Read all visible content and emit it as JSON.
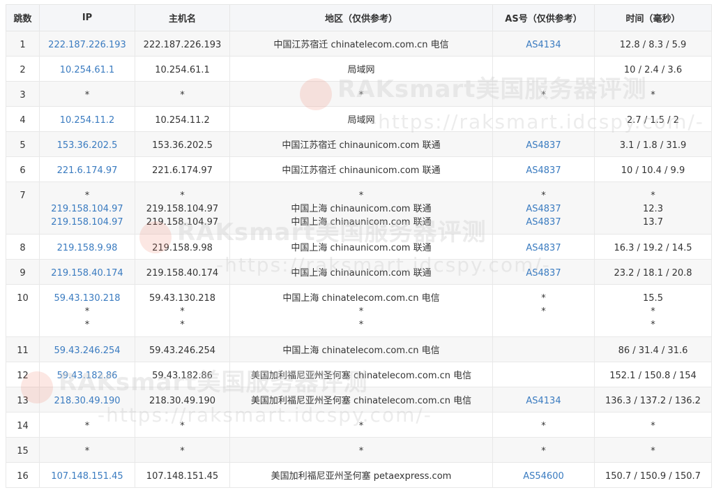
{
  "headers": [
    "跳数",
    "IP",
    "主机名",
    "地区（仅供参考）",
    "AS号（仅供参考）",
    "时间（毫秒）"
  ],
  "rows": [
    {
      "hop": "1",
      "ip": [
        "222.187.226.193"
      ],
      "host": [
        "222.187.226.193"
      ],
      "region": [
        "中国江苏宿迁 chinatelecom.com.cn 电信"
      ],
      "as": [
        "AS4134"
      ],
      "time": [
        "12.8 / 8.3 / 5.9"
      ]
    },
    {
      "hop": "2",
      "ip": [
        "10.254.61.1"
      ],
      "host": [
        "10.254.61.1"
      ],
      "region": [
        "局域网"
      ],
      "as": [
        ""
      ],
      "time": [
        "10 / 2.4 / 3.6"
      ]
    },
    {
      "hop": "3",
      "ip": [
        "*"
      ],
      "host": [
        "*"
      ],
      "region": [
        "*"
      ],
      "as": [
        "*"
      ],
      "time": [
        "*"
      ]
    },
    {
      "hop": "4",
      "ip": [
        "10.254.11.2"
      ],
      "host": [
        "10.254.11.2"
      ],
      "region": [
        "局域网"
      ],
      "as": [
        ""
      ],
      "time": [
        "2.7 / 1.5 / 2"
      ]
    },
    {
      "hop": "5",
      "ip": [
        "153.36.202.5"
      ],
      "host": [
        "153.36.202.5"
      ],
      "region": [
        "中国江苏宿迁 chinaunicom.com 联通"
      ],
      "as": [
        "AS4837"
      ],
      "time": [
        "3.1 / 1.8 / 31.9"
      ]
    },
    {
      "hop": "6",
      "ip": [
        "221.6.174.97"
      ],
      "host": [
        "221.6.174.97"
      ],
      "region": [
        "中国江苏宿迁 chinaunicom.com 联通"
      ],
      "as": [
        "AS4837"
      ],
      "time": [
        "10 / 10.4 / 9.9"
      ]
    },
    {
      "hop": "7",
      "ip": [
        "*",
        "219.158.104.97",
        "219.158.104.97"
      ],
      "host": [
        "*",
        "219.158.104.97",
        "219.158.104.97"
      ],
      "region": [
        "*",
        "中国上海 chinaunicom.com 联通",
        "中国上海 chinaunicom.com 联通"
      ],
      "as": [
        "*",
        "AS4837",
        "AS4837"
      ],
      "time": [
        "*",
        "12.3",
        "13.7"
      ]
    },
    {
      "hop": "8",
      "ip": [
        "219.158.9.98"
      ],
      "host": [
        "219.158.9.98"
      ],
      "region": [
        "中国上海 chinaunicom.com 联通"
      ],
      "as": [
        "AS4837"
      ],
      "time": [
        "16.3 / 19.2 / 14.5"
      ]
    },
    {
      "hop": "9",
      "ip": [
        "219.158.40.174"
      ],
      "host": [
        "219.158.40.174"
      ],
      "region": [
        "中国上海 chinaunicom.com 联通"
      ],
      "as": [
        "AS4837"
      ],
      "time": [
        "23.2 / 18.1 / 20.8"
      ]
    },
    {
      "hop": "10",
      "ip": [
        "59.43.130.218",
        "*",
        "*"
      ],
      "host": [
        "59.43.130.218",
        "*",
        "*"
      ],
      "region": [
        "中国上海 chinatelecom.com.cn 电信",
        "*",
        "*"
      ],
      "as": [
        "",
        "*",
        "*"
      ],
      "time": [
        "15.5",
        "*",
        "*"
      ]
    },
    {
      "hop": "11",
      "ip": [
        "59.43.246.254"
      ],
      "host": [
        "59.43.246.254"
      ],
      "region": [
        "中国上海 chinatelecom.com.cn 电信"
      ],
      "as": [
        ""
      ],
      "time": [
        "86 / 31.4 / 31.6"
      ]
    },
    {
      "hop": "12",
      "ip": [
        "59.43.182.86"
      ],
      "host": [
        "59.43.182.86"
      ],
      "region": [
        "美国加利福尼亚州圣何塞 chinatelecom.com.cn 电信"
      ],
      "as": [
        ""
      ],
      "time": [
        "152.1 / 150.8 / 154"
      ]
    },
    {
      "hop": "13",
      "ip": [
        "218.30.49.190"
      ],
      "host": [
        "218.30.49.190"
      ],
      "region": [
        "美国加利福尼亚州圣何塞 chinatelecom.com.cn 电信"
      ],
      "as": [
        "AS4134"
      ],
      "time": [
        "136.3 / 137.2 / 136.2"
      ]
    },
    {
      "hop": "14",
      "ip": [
        "*"
      ],
      "host": [
        "*"
      ],
      "region": [
        "*"
      ],
      "as": [
        "*"
      ],
      "time": [
        "*"
      ]
    },
    {
      "hop": "15",
      "ip": [
        "*"
      ],
      "host": [
        "*"
      ],
      "region": [
        "*"
      ],
      "as": [
        "*"
      ],
      "time": [
        "*"
      ]
    },
    {
      "hop": "16",
      "ip": [
        "107.148.151.45"
      ],
      "host": [
        "107.148.151.45"
      ],
      "region": [
        "美国加利福尼亚州圣何塞 petaexpress.com"
      ],
      "as": [
        "AS54600"
      ],
      "time": [
        "150.7 / 150.9 / 150.7"
      ]
    }
  ],
  "watermark": {
    "title": "RAKsmart美国服务器评测",
    "url": "-https://raksmart.idcspy.com/-"
  },
  "colors": {
    "link": "#3a7bc0",
    "header_bg": "#f5f6f8",
    "stripe_bg": "#f7f7f7"
  }
}
